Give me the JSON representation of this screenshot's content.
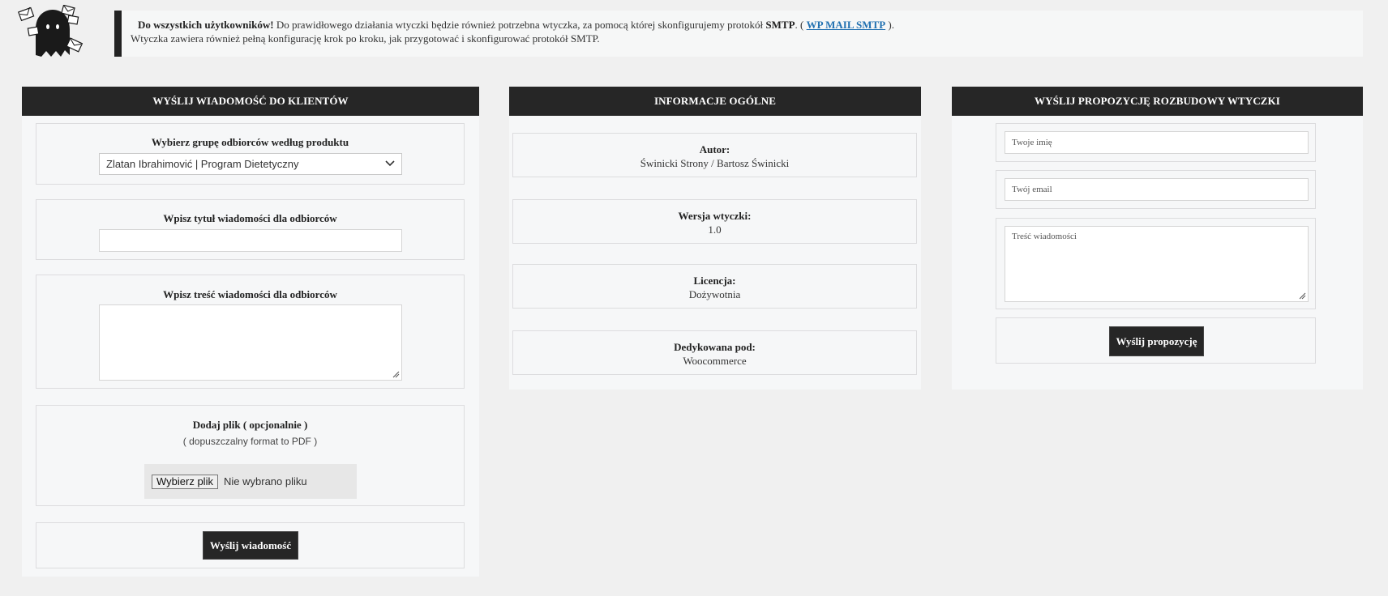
{
  "notice": {
    "bold": "Do wszystkich użytkowników!",
    "text1": " Do prawidłowego działania wtyczki będzie również potrzebna wtyczka, za pomocą której skonfigurujemy protokół ",
    "smtp": "SMTP",
    "text2": ". ( ",
    "link": "WP MAIL SMTP",
    "text3": " ).",
    "line2": "Wtyczka zawiera również pełną konfigurację krok po kroku, jak przygotować i skonfigurować protokół SMTP."
  },
  "send_panel": {
    "title": "WYŚLIJ WIADOMOŚĆ DO KLIENTÓW",
    "group_label": "Wybierz grupę odbiorców według produktu",
    "group_selected": "Zlatan Ibrahimović | Program Dietetyczny",
    "title_label": "Wpisz tytuł wiadomości dla odbiorców",
    "body_label": "Wpisz treść wiadomości dla odbiorców",
    "file_label": "Dodaj plik ( opcjonalnie )",
    "file_hint": "( dopuszczalny format to PDF )",
    "file_button": "Wybierz plik",
    "file_none": "Nie wybrano pliku",
    "send_button": "Wyślij wiadomość"
  },
  "info_panel": {
    "title": "INFORMACJE OGÓLNE",
    "items": [
      {
        "label": "Autor:",
        "value": "Świnicki Strony / Bartosz Świnicki"
      },
      {
        "label": "Wersja wtyczki:",
        "value": "1.0"
      },
      {
        "label": "Licencja:",
        "value": "Dożywotnia"
      },
      {
        "label": "Dedykowana pod:",
        "value": "Woocommerce"
      }
    ]
  },
  "proposal_panel": {
    "title": "WYŚLIJ PROPOZYCJĘ ROZBUDOWY WTYCZKI",
    "name_placeholder": "Twoje imię",
    "email_placeholder": "Twój email",
    "message_placeholder": "Treść wiadomości",
    "send_button": "Wyślij propozycję"
  },
  "colors": {
    "header_bg": "#262626",
    "page_bg": "#f0f0f0",
    "panel_bg": "#f6f7f8",
    "link": "#2271b1"
  }
}
